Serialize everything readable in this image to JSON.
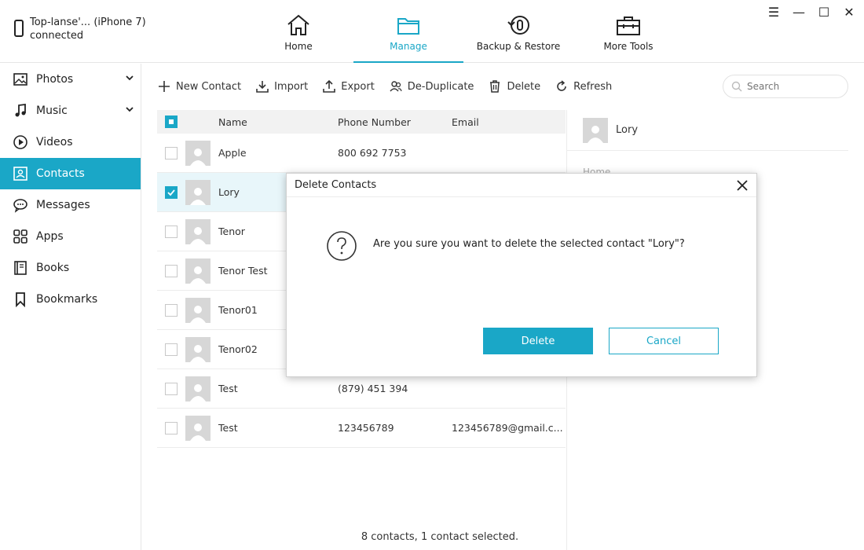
{
  "device": {
    "line1": "Top-lanse'... (iPhone 7)",
    "line2": "connected"
  },
  "nav": [
    {
      "label": "Home",
      "icon": "home-icon"
    },
    {
      "label": "Manage",
      "icon": "folder-icon",
      "active": true
    },
    {
      "label": "Backup & Restore",
      "icon": "backup-icon"
    },
    {
      "label": "More Tools",
      "icon": "toolbox-icon"
    }
  ],
  "window": {
    "menu": "☰",
    "minimize": "—",
    "maximize": "☐",
    "close": "✕"
  },
  "sidebar": {
    "items": [
      {
        "label": "Photos",
        "icon": "photo-icon"
      },
      {
        "label": "Music",
        "icon": "music-icon"
      },
      {
        "label": "Videos",
        "icon": "video-icon"
      },
      {
        "label": "Contacts",
        "icon": "contact-icon",
        "active": true
      },
      {
        "label": "Messages",
        "icon": "message-icon"
      },
      {
        "label": "Apps",
        "icon": "apps-icon"
      },
      {
        "label": "Books",
        "icon": "book-icon"
      },
      {
        "label": "Bookmarks",
        "icon": "bookmark-icon"
      }
    ]
  },
  "toolbar": {
    "new_contact": "New Contact",
    "import": "Import",
    "export": "Export",
    "deduplicate": "De-Duplicate",
    "delete": "Delete",
    "refresh": "Refresh"
  },
  "search": {
    "placeholder": "Search"
  },
  "table": {
    "headers": {
      "name": "Name",
      "phone": "Phone Number",
      "email": "Email"
    },
    "rows": [
      {
        "name": "Apple",
        "phone": "800 692 7753",
        "email": ""
      },
      {
        "name": "Lory",
        "phone": "",
        "email": "",
        "selected": true
      },
      {
        "name": "Tenor",
        "phone": "",
        "email": ""
      },
      {
        "name": "Tenor Test",
        "phone": "",
        "email": ""
      },
      {
        "name": "Tenor01",
        "phone": "",
        "email": ""
      },
      {
        "name": "Tenor02",
        "phone": "",
        "email": ""
      },
      {
        "name": "Test",
        "phone": "(879) 451 394",
        "email": ""
      },
      {
        "name": "Test",
        "phone": "123456789",
        "email": "123456789@gmail.c..."
      }
    ]
  },
  "detail": {
    "name": "Lory",
    "label": "Home"
  },
  "status": "8 contacts, 1 contact selected.",
  "dialog": {
    "title": "Delete Contacts",
    "message": "Are you sure you want to delete the selected contact \"Lory\"?",
    "delete_label": "Delete",
    "cancel_label": "Cancel"
  },
  "colors": {
    "accent": "#1aa7c7"
  }
}
